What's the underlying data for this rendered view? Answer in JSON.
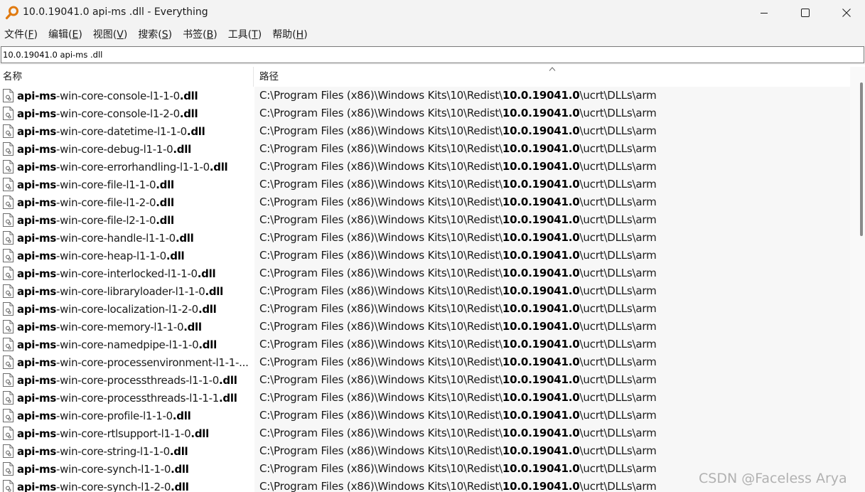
{
  "window": {
    "title": "10.0.19041.0 api-ms .dll - Everything",
    "icon": "magnifier-key-icon",
    "accent": "#e07a10"
  },
  "menu": [
    {
      "label": "文件(",
      "key": "F",
      "suffix": ")"
    },
    {
      "label": "编辑(",
      "key": "E",
      "suffix": ")"
    },
    {
      "label": "视图(",
      "key": "V",
      "suffix": ")"
    },
    {
      "label": "搜索(",
      "key": "S",
      "suffix": ")"
    },
    {
      "label": "书签(",
      "key": "B",
      "suffix": ")"
    },
    {
      "label": "工具(",
      "key": "T",
      "suffix": ")"
    },
    {
      "label": "帮助(",
      "key": "H",
      "suffix": ")"
    }
  ],
  "search": {
    "value": "10.0.19041.0 api-ms .dll"
  },
  "columns": {
    "name": "名称",
    "path": "路径"
  },
  "path": {
    "prefix": "C:\\Program Files (x86)\\Windows Kits\\10\\Redist\\",
    "match": "10.0.19041.0",
    "suffix": "\\ucrt\\DLLs\\arm"
  },
  "files": [
    {
      "a": "api-ms",
      "b": "-win-core-console-l1-1-0",
      "c": ".dll"
    },
    {
      "a": "api-ms",
      "b": "-win-core-console-l1-2-0",
      "c": ".dll"
    },
    {
      "a": "api-ms",
      "b": "-win-core-datetime-l1-1-0",
      "c": ".dll"
    },
    {
      "a": "api-ms",
      "b": "-win-core-debug-l1-1-0",
      "c": ".dll"
    },
    {
      "a": "api-ms",
      "b": "-win-core-errorhandling-l1-1-0",
      "c": ".dll"
    },
    {
      "a": "api-ms",
      "b": "-win-core-file-l1-1-0",
      "c": ".dll"
    },
    {
      "a": "api-ms",
      "b": "-win-core-file-l1-2-0",
      "c": ".dll"
    },
    {
      "a": "api-ms",
      "b": "-win-core-file-l2-1-0",
      "c": ".dll"
    },
    {
      "a": "api-ms",
      "b": "-win-core-handle-l1-1-0",
      "c": ".dll"
    },
    {
      "a": "api-ms",
      "b": "-win-core-heap-l1-1-0",
      "c": ".dll"
    },
    {
      "a": "api-ms",
      "b": "-win-core-interlocked-l1-1-0",
      "c": ".dll"
    },
    {
      "a": "api-ms",
      "b": "-win-core-libraryloader-l1-1-0",
      "c": ".dll"
    },
    {
      "a": "api-ms",
      "b": "-win-core-localization-l1-2-0",
      "c": ".dll"
    },
    {
      "a": "api-ms",
      "b": "-win-core-memory-l1-1-0",
      "c": ".dll"
    },
    {
      "a": "api-ms",
      "b": "-win-core-namedpipe-l1-1-0",
      "c": ".dll"
    },
    {
      "a": "api-ms",
      "b": "-win-core-processenvironment-l1-1-...",
      "c": ""
    },
    {
      "a": "api-ms",
      "b": "-win-core-processthreads-l1-1-0",
      "c": ".dll"
    },
    {
      "a": "api-ms",
      "b": "-win-core-processthreads-l1-1-1",
      "c": ".dll"
    },
    {
      "a": "api-ms",
      "b": "-win-core-profile-l1-1-0",
      "c": ".dll"
    },
    {
      "a": "api-ms",
      "b": "-win-core-rtlsupport-l1-1-0",
      "c": ".dll"
    },
    {
      "a": "api-ms",
      "b": "-win-core-string-l1-1-0",
      "c": ".dll"
    },
    {
      "a": "api-ms",
      "b": "-win-core-synch-l1-1-0",
      "c": ".dll"
    },
    {
      "a": "api-ms",
      "b": "-win-core-synch-l1-2-0",
      "c": ".dll"
    }
  ],
  "watermark": "CSDN @Faceless Arya"
}
